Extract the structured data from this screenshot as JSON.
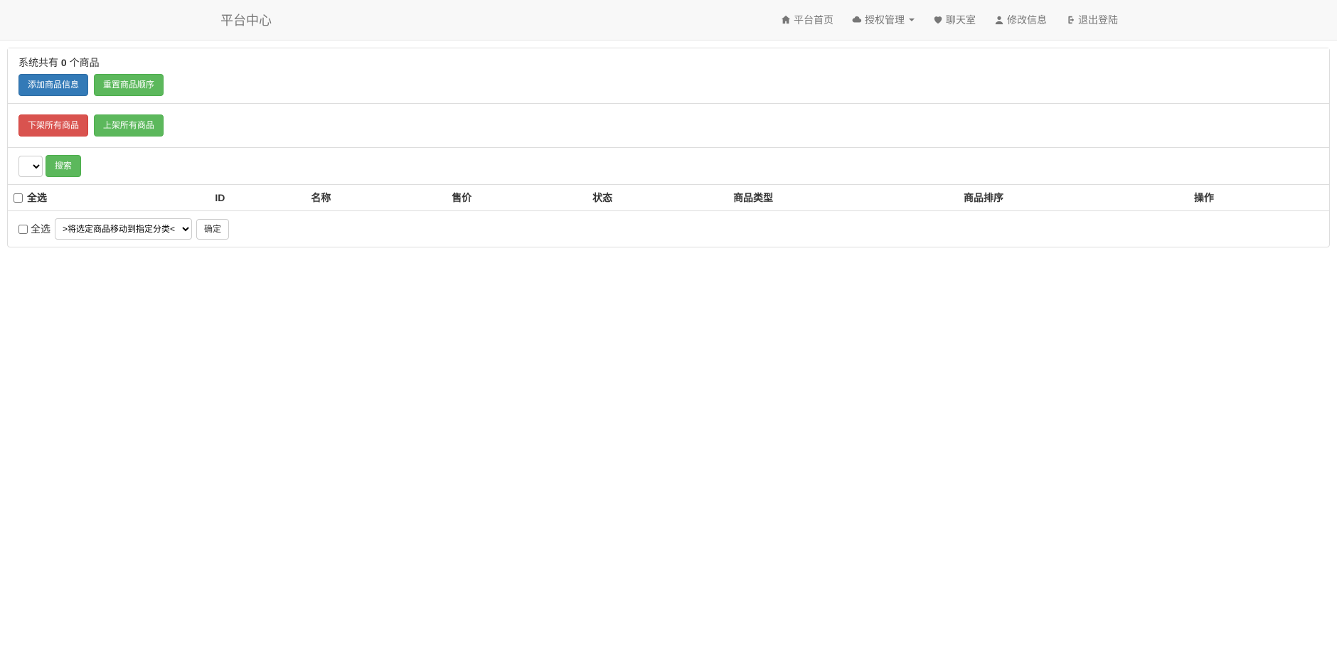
{
  "navbar": {
    "brand": "平台中心",
    "items": [
      {
        "label": "平台首页"
      },
      {
        "label": "授权管理"
      },
      {
        "label": "聊天室"
      },
      {
        "label": "修改信息"
      },
      {
        "label": "退出登陆"
      }
    ]
  },
  "summary": {
    "prefix": "系统共有 ",
    "count": "0",
    "suffix": " 个商品"
  },
  "buttons": {
    "add_product": "添加商品信息",
    "reset_order": "重置商品顺序",
    "remove_all": "下架所有商品",
    "list_all": "上架所有商品",
    "search": "搜索",
    "confirm": "确定"
  },
  "table": {
    "select_all": "全选",
    "headers": [
      "ID",
      "名称",
      "售价",
      "状态",
      "商品类型",
      "商品排序",
      "操作"
    ]
  },
  "footer": {
    "select_all": "全选",
    "move_select_placeholder": ">将选定商品移动到指定分类<"
  }
}
